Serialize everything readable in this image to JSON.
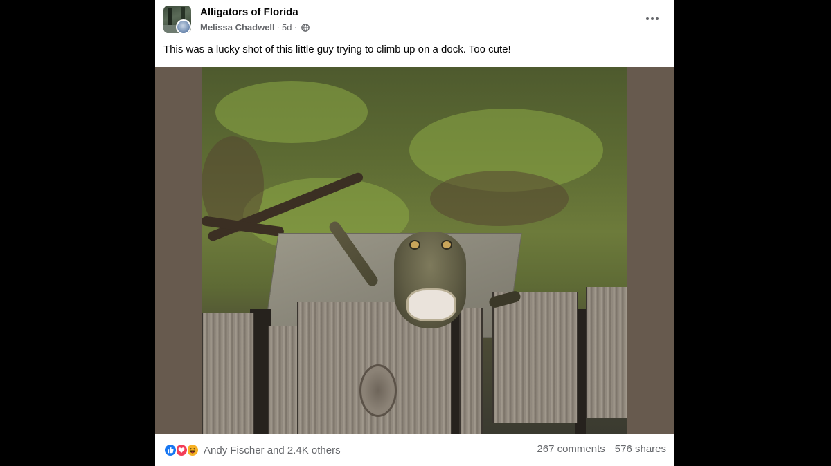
{
  "post": {
    "group_name": "Alligators of Florida",
    "author": "Melissa Chadwell",
    "separator": "·",
    "time_ago": "5d",
    "text": "This was a lucky shot of this little guy trying to climb up on a dock. Too cute!",
    "privacy_icon": "globe-icon",
    "more_icon": "more-horizontal-icon"
  },
  "media": {
    "subject": "photo"
  },
  "footer": {
    "reaction_icons": [
      "like-icon",
      "love-icon",
      "haha-icon"
    ],
    "reactions_summary": "Andy Fischer and 2.4K others",
    "comments": "267 comments",
    "shares": "576 shares"
  },
  "colors": {
    "background": "#000000",
    "card": "#ffffff",
    "primary_text": "#050505",
    "secondary_text": "#65676b",
    "media_letterbox": "#675a4e",
    "like_blue": "#1877f2",
    "love_red": "#f33e58",
    "haha_yellow": "#f7b125"
  }
}
